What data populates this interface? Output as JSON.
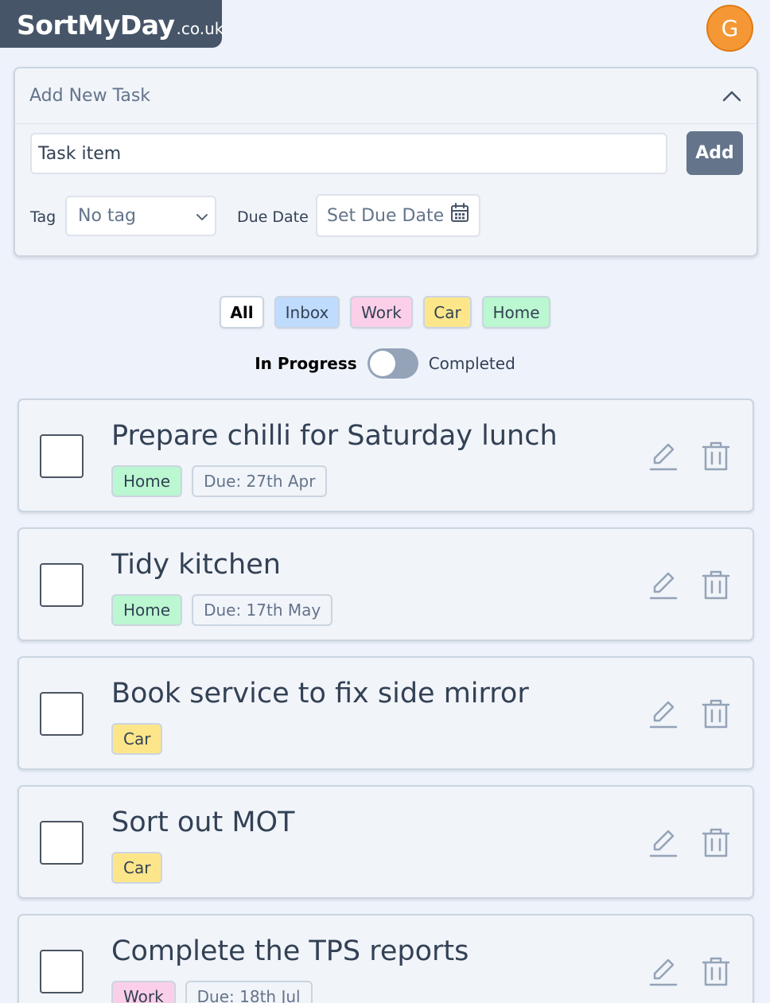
{
  "header": {
    "brand": "SortMyDay",
    "tld": ".co.uk",
    "avatar_initial": "G"
  },
  "add_task": {
    "title": "Add New Task",
    "input_placeholder": "Task item",
    "add_label": "Add",
    "tag_label": "Tag",
    "tag_value": "No tag",
    "due_label": "Due Date",
    "due_button": "Set Due Date"
  },
  "filters": {
    "all": "All",
    "inbox": "Inbox",
    "work": "Work",
    "car": "Car",
    "home": "Home",
    "selected": "All"
  },
  "status_toggle": {
    "left": "In Progress",
    "right": "Completed",
    "state": "In Progress"
  },
  "colors": {
    "tag_home": "#bbf7d0",
    "tag_car": "#fde68a",
    "tag_work": "#fbcfe8",
    "tag_inbox": "#bfdbfe",
    "avatar": "#f59735",
    "brand_bg": "#475569"
  },
  "tasks": [
    {
      "title": "Prepare chilli for Saturday lunch",
      "tag": "Home",
      "due": "Due: 27th Apr"
    },
    {
      "title": "Tidy kitchen",
      "tag": "Home",
      "due": "Due: 17th May"
    },
    {
      "title": "Book service to fix side mirror",
      "tag": "Car",
      "due": ""
    },
    {
      "title": "Sort out MOT",
      "tag": "Car",
      "due": ""
    },
    {
      "title": "Complete the TPS reports",
      "tag": "Work",
      "due": "Due: 18th Jul"
    }
  ]
}
